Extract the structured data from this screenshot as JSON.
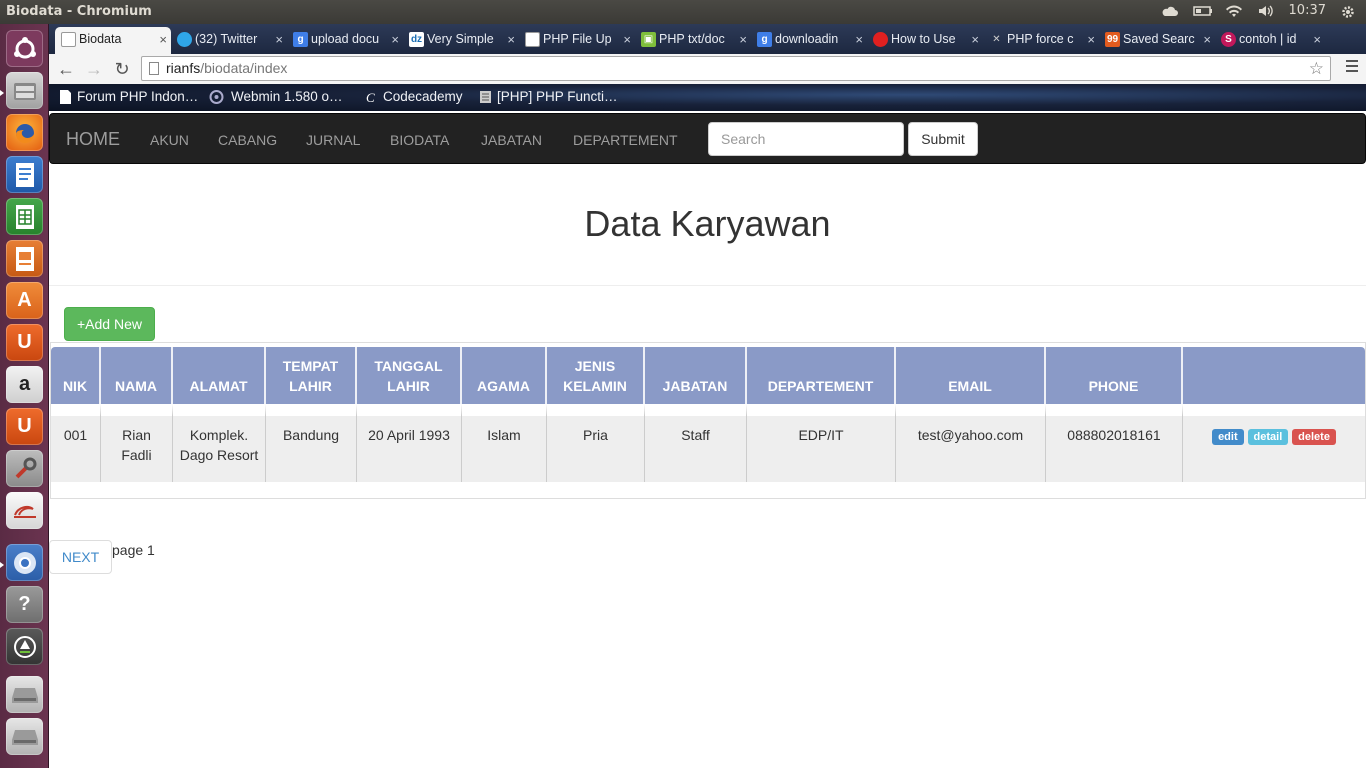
{
  "window": {
    "title": "Biodata - Chromium",
    "clock": "10:37"
  },
  "launcher": {
    "icons": [
      "ubuntu-dash-icon",
      "files-icon",
      "firefox-icon",
      "writer-icon",
      "calc-icon",
      "impress-icon",
      "software-center-icon",
      "ubuntu-one-icon",
      "amazon-icon",
      "ubuntu-one-music-icon",
      "system-settings-icon",
      "email-icon",
      "chromium-icon",
      "help-icon",
      "software-updater-icon",
      "drive-icon",
      "drive-icon"
    ]
  },
  "tabs": [
    {
      "label": "Biodata",
      "favicon": "page-icon",
      "active": true
    },
    {
      "label": "(32) Twitter",
      "favicon": "twitter-icon"
    },
    {
      "label": "upload docu",
      "favicon": "google-icon"
    },
    {
      "label": "Very Simple",
      "favicon": "dz-icon"
    },
    {
      "label": "PHP File Up",
      "favicon": "page-icon"
    },
    {
      "label": "PHP txt/doc",
      "favicon": "stack-icon"
    },
    {
      "label": "downloadin",
      "favicon": "google-icon"
    },
    {
      "label": "How to Use",
      "favicon": "red-dot-icon"
    },
    {
      "label": "PHP force c",
      "favicon": "tools-icon"
    },
    {
      "label": "Saved Searc",
      "favicon": "99-icon"
    },
    {
      "label": "contoh | id",
      "favicon": "s-icon"
    }
  ],
  "address": {
    "host": "rianfs",
    "path": "/biodata/index"
  },
  "bookmarks": [
    {
      "label": "Forum PHP Indon…",
      "icon": "page-icon"
    },
    {
      "label": "Webmin 1.580 o…",
      "icon": "webmin-icon"
    },
    {
      "label": "Codecademy",
      "icon": "codecademy-icon"
    },
    {
      "label": "[PHP] PHP Functi…",
      "icon": "bookmark-icon"
    }
  ],
  "navbar": {
    "brand": "HOME",
    "links": [
      "AKUN",
      "CABANG",
      "JURNAL",
      "BIODATA",
      "JABATAN",
      "DEPARTEMENT"
    ],
    "search_placeholder": "Search",
    "submit_label": "Submit"
  },
  "main": {
    "title": "Data Karyawan",
    "add_label": "+Add New",
    "next_label": "NEXT",
    "page_label": "page 1"
  },
  "table": {
    "headers": [
      "NIK",
      "NAMA",
      "ALAMAT",
      "TEMPAT LAHIR",
      "TANGGAL LAHIR",
      "AGAMA",
      "JENIS KELAMIN",
      "JABATAN",
      "DEPARTEMENT",
      "EMAIL",
      "PHONE",
      ""
    ],
    "rows": [
      {
        "cells": [
          "001",
          "Rian Fadli",
          "Komplek. Dago Resort",
          "Bandung",
          "20 April 1993",
          "Islam",
          "Pria",
          "Staff",
          "EDP/IT",
          "test@yahoo.com",
          "088802018161"
        ],
        "actions": [
          "edit",
          "detail",
          "delete"
        ]
      }
    ]
  },
  "colors": {
    "header": "#8a9ac7",
    "add": "#5cb85c",
    "edit": "#428bca",
    "detail": "#5bc0de",
    "delete": "#d9534f",
    "navbar": "#222222"
  }
}
